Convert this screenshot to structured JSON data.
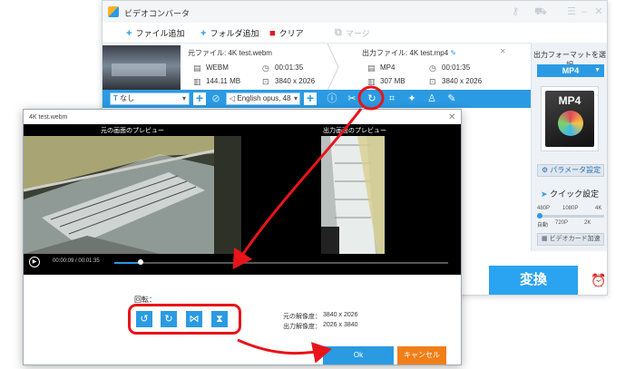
{
  "main_window": {
    "title": "ビデオコンバータ",
    "toolbar": {
      "add_file": "ファイル追加",
      "add_folder": "フォルダ追加",
      "clear": "クリア",
      "merge": "マージ"
    },
    "source": {
      "label": "元ファイル:",
      "filename": "4K test.webm",
      "format": "WEBM",
      "duration": "00:01:35",
      "size": "144.11 MB",
      "resolution": "3840 x 2026"
    },
    "output": {
      "label": "出力ファイル:",
      "filename": "4K test.mp4",
      "format": "MP4",
      "duration": "00:01:35",
      "size": "307 MB",
      "resolution": "3840 x 2026"
    },
    "file_toolbar": {
      "subtitle_value": "なし",
      "audio_value": "English opus, 48"
    },
    "right_panel": {
      "output_format_label": "出力フォーマットを選択",
      "format_value": "MP4",
      "tile_text": "MP4",
      "param_button": "パラメータ設定",
      "quick_settings": "クイック設定",
      "quality_top": [
        "480P",
        "1080P",
        "4K"
      ],
      "quality_bottom": [
        "自動",
        "720P",
        "2K"
      ],
      "gpu_button": "ビデオカード加速"
    },
    "convert_button": "変換"
  },
  "dialog": {
    "title": "4K test.webm",
    "source_preview_label": "元の画面のプレビュー",
    "output_preview_label": "出力画面のプレビュー",
    "time_current": "00:00:09",
    "time_total": "00:01:35",
    "time_separator": "/",
    "seek_progress": 0.08,
    "rotate_label": "回転：",
    "source_res_label": "元の解像度：",
    "source_res_value": "3840 x 2026",
    "output_res_label": "出力解像度：",
    "output_res_value": "2026 x 3840",
    "ok_button": "Ok",
    "cancel_button": "キャンセル"
  },
  "colors": {
    "accent": "#2a9be3",
    "highlight": "#e8141a",
    "cancel": "#f07f19"
  }
}
